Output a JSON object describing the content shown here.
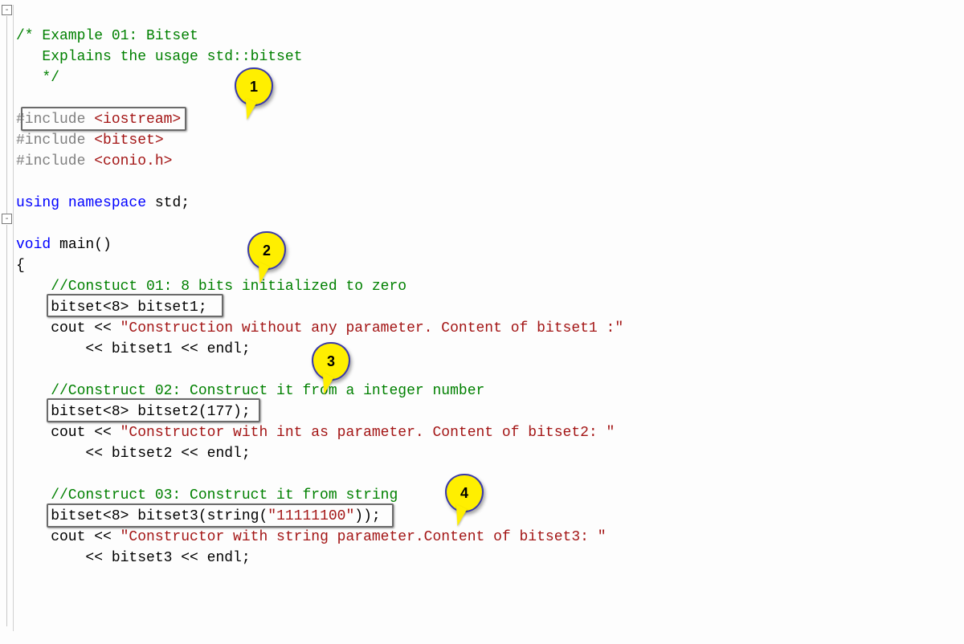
{
  "fold_glyph": "-",
  "code": {
    "l1_cm": "/* Example 01: Bitset",
    "l2_cm": "   Explains the usage std::bitset",
    "l3_cm": "   */",
    "l4": "",
    "l5_pp": "#include ",
    "l5_hdr": "<iostream>",
    "l6_pp": "#include ",
    "l6_hdr": "<bitset>",
    "l7_pp": "#include ",
    "l7_hdr": "<conio.h>",
    "l8": "",
    "l9_kw1": "using",
    "l9_kw2": " namespace",
    "l9_pl": " std;",
    "l10": "",
    "l11_kw": "void",
    "l11_pl": " main()",
    "l12_pl": "{",
    "l13_cm": "    //Constuct 01: 8 bits initialized to zero",
    "l14_pl": "    bitset<8> bitset1;",
    "l15a_pl": "    cout << ",
    "l15a_str": "\"Construction without any parameter. Content of bitset1 :\"",
    "l15b_pl": "        << bitset1 << endl;",
    "l16": "",
    "l17_cm": "    //Construct 02: Construct it from a integer number",
    "l18_pl": "    bitset<8> bitset2(177);",
    "l19a_pl": "    cout << ",
    "l19a_str": "\"Constructor with int as parameter. Content of bitset2: \"",
    "l19b_pl": "        << bitset2 << endl;",
    "l20": "",
    "l21_cm": "    //Construct 03: Construct it from string",
    "l22a_pl": "    bitset<8> bitset3(string(",
    "l22a_str": "\"11111100\"",
    "l22a_pl2": "));",
    "l22b_pl": "    cout << ",
    "l22b_str": "\"Constructor with string parameter.Content of bitset3: \"",
    "l22c_pl": "        << bitset3 << endl;"
  },
  "callouts": {
    "c1": "1",
    "c2": "2",
    "c3": "3",
    "c4": "4"
  }
}
